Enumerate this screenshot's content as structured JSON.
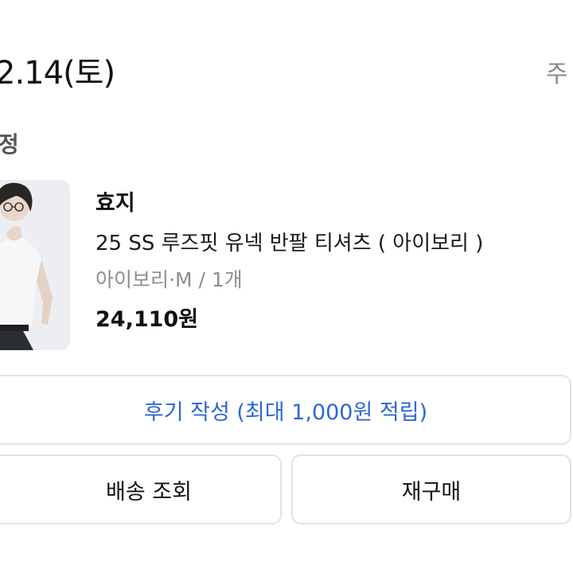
{
  "order": {
    "date": "2.14(토)",
    "detail_link": "주"
  },
  "status": {
    "label": "정"
  },
  "product": {
    "brand": "효지",
    "name": "25 SS 루즈핏 유넥 반팔 티셔츠 ( 아이보리 )",
    "option": "아이보리·M / 1개",
    "price": "24,110원"
  },
  "actions": {
    "review_label": "후기 작성 (최대 1,000원 적립)",
    "track_label": "배송 조회",
    "rebuy_label": "재구매"
  },
  "colors": {
    "accent": "#2f66d6",
    "muted_text": "#8d8d8d",
    "border": "#e3e3e3"
  }
}
